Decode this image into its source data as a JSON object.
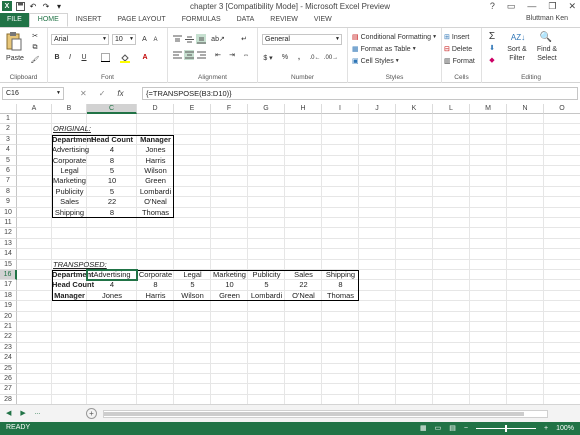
{
  "window": {
    "title": "chapter 3  [Compatibility Mode] - Microsoft Excel Preview",
    "help": "?",
    "user": "Bluttman Ken",
    "controls": [
      "▭",
      "—",
      "❐",
      "✕"
    ]
  },
  "tabs": [
    "FILE",
    "HOME",
    "INSERT",
    "PAGE LAYOUT",
    "FORMULAS",
    "DATA",
    "REVIEW",
    "VIEW"
  ],
  "ribbon": {
    "clipboard": {
      "paste": "Paste",
      "label": "Clipboard"
    },
    "font": {
      "name": "Arial",
      "size": "10",
      "label": "Font"
    },
    "alignment": {
      "label": "Alignment"
    },
    "number": {
      "format": "General",
      "label": "Number"
    },
    "styles": {
      "conditional": "Conditional Formatting",
      "table": "Format as Table",
      "cell_styles": "Cell Styles",
      "label": "Styles"
    },
    "cells": {
      "insert": "Insert",
      "delete": "Delete",
      "format": "Format",
      "label": "Cells"
    },
    "editing": {
      "sort": "Sort &",
      "filter": "Filter",
      "find": "Find &",
      "select": "Select",
      "label": "Editing"
    }
  },
  "formula_bar": {
    "cell_ref": "C16",
    "fx": "fx",
    "formula": "{=TRANSPOSE(B3:D10)}"
  },
  "columns": [
    "A",
    "B",
    "C",
    "D",
    "E",
    "F",
    "G",
    "H",
    "I",
    "J",
    "K",
    "L",
    "M",
    "N",
    "O"
  ],
  "rows": [
    "1",
    "2",
    "3",
    "4",
    "5",
    "6",
    "7",
    "8",
    "9",
    "10",
    "11",
    "12",
    "13",
    "14",
    "15",
    "16",
    "17",
    "18",
    "19",
    "20",
    "21",
    "22",
    "23",
    "24",
    "25",
    "26",
    "27",
    "28"
  ],
  "sheet": {
    "original_label": "ORIGINAL:",
    "original_headers": [
      "Department",
      "Head Count",
      "Manager"
    ],
    "original_rows": [
      [
        "Advertising",
        "4",
        "Jones"
      ],
      [
        "Corporate",
        "8",
        "Harris"
      ],
      [
        "Legal",
        "5",
        "Wilson"
      ],
      [
        "Marketing",
        "10",
        "Green"
      ],
      [
        "Publicity",
        "5",
        "Lombardi"
      ],
      [
        "Sales",
        "22",
        "O'Neal"
      ],
      [
        "Shipping",
        "8",
        "Thomas"
      ]
    ],
    "transposed_label": "TRANSPOSED:",
    "transposed_rows": [
      [
        "Department",
        "Advertising",
        "Corporate",
        "Legal",
        "Marketing",
        "Publicity",
        "Sales",
        "Shipping"
      ],
      [
        "Head Count",
        "4",
        "8",
        "5",
        "10",
        "5",
        "22",
        "8"
      ],
      [
        "Manager",
        "Jones",
        "Harris",
        "Wilson",
        "Green",
        "Lombardi",
        "O'Neal",
        "Thomas"
      ]
    ]
  },
  "sheetbar": {
    "nav": [
      "◀",
      "▶",
      "..."
    ],
    "add": "+"
  },
  "status": {
    "ready": "READY",
    "zoom": "100%"
  }
}
